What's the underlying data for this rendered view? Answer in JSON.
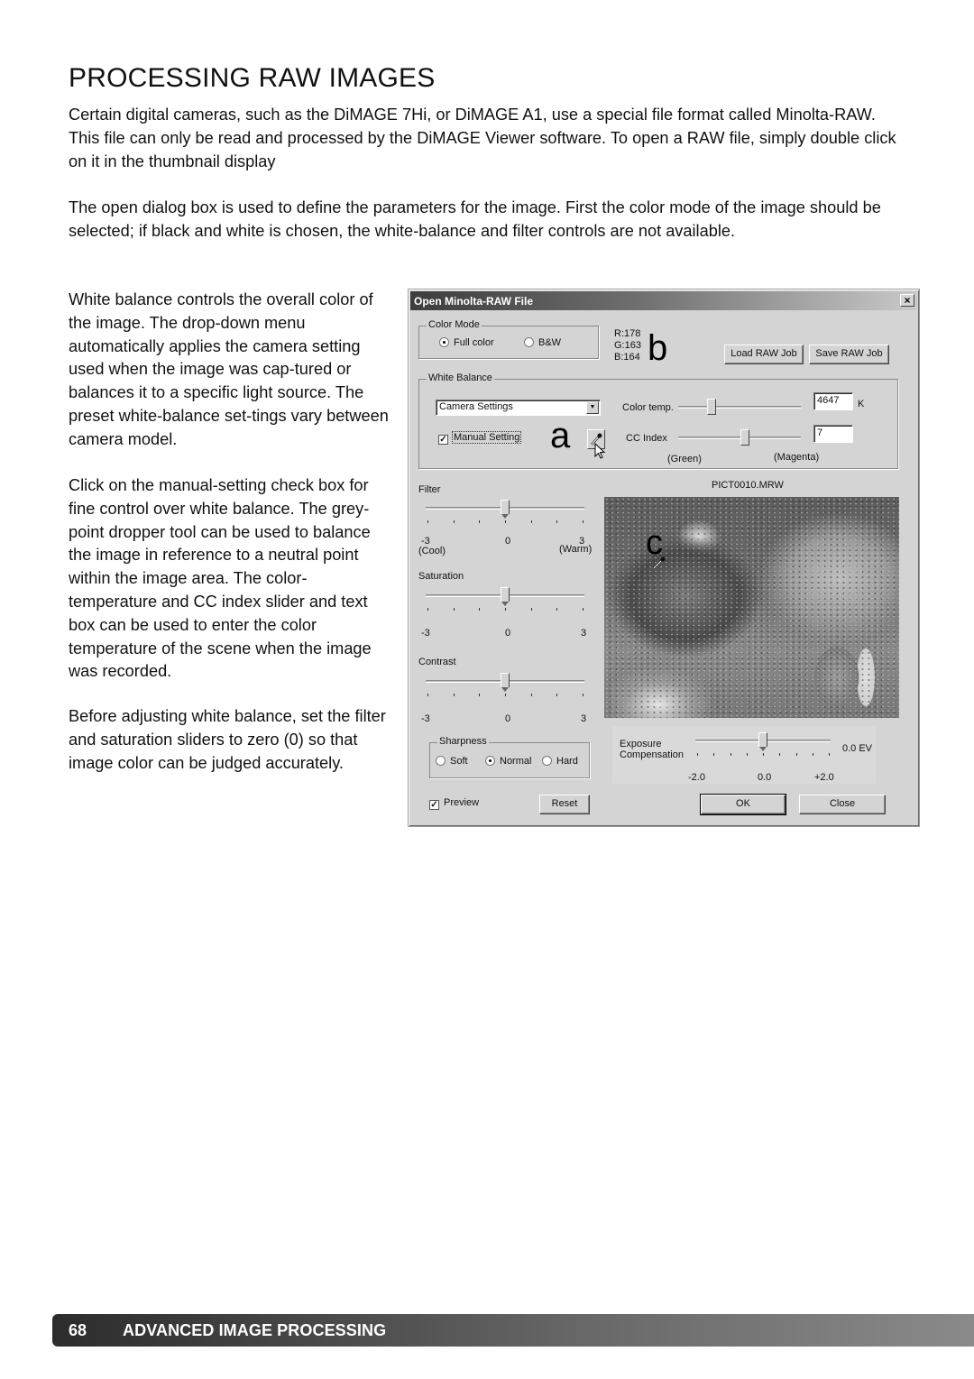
{
  "page": {
    "title": "PROCESSING RAW IMAGES",
    "paragraphs": [
      "Certain digital cameras, such as the DiMAGE 7Hi, or DiMAGE A1, use a special file format called Minolta-RAW. This file can only be read and processed by the DiMAGE Viewer software. To open a RAW file, simply double click on it in the thumbnail display",
      "The open dialog box is used to define the parameters for the image. First the color mode of the image should be selected; if black and white is chosen, the white-balance and filter controls are not available.",
      "White balance controls the overall color of the image. The drop-down menu automatically applies the camera setting used when the image was cap-tured or balances it to a specific light source. The preset white-balance set-tings vary between camera model.",
      "Click on the manual-setting check box for fine control over white balance. The grey-point dropper tool can be used to balance the image in reference to a neutral point within the image area. The color-temperature and CC index slider and text box can be used to enter the color temperature of the scene when the image was recorded.",
      "Before adjusting white balance, set the filter and saturation sliders to zero (0) so that image color can be judged accurately."
    ],
    "footer": {
      "page_number": "68",
      "section": "ADVANCED IMAGE PROCESSING"
    }
  },
  "dialog": {
    "title": "Open Minolta-RAW File",
    "close_label": "×",
    "color_mode": {
      "label": "Color Mode",
      "options": [
        {
          "label": "Full color",
          "selected": true
        },
        {
          "label": "B&W",
          "selected": false
        }
      ]
    },
    "rgb_readout": {
      "r": "R:178",
      "g": "G:163",
      "b": "B:164"
    },
    "callouts": {
      "a": "a",
      "b": "b",
      "c": "c"
    },
    "load_button": "Load RAW Job",
    "save_button": "Save RAW Job",
    "white_balance": {
      "label": "White Balance",
      "preset_value": "Camera Settings",
      "manual_setting_label": "Manual Setting",
      "manual_setting_checked": true,
      "color_temp_label": "Color temp.",
      "color_temp_value": "4647",
      "color_temp_unit": "K",
      "color_temp_slider_fraction": 0.25,
      "cc_index_label": "CC Index",
      "cc_index_value": "7",
      "cc_index_slider_fraction": 0.55,
      "green_label": "(Green)",
      "magenta_label": "(Magenta)"
    },
    "filter": {
      "label": "Filter",
      "value": 0,
      "min_label": "-3",
      "mid_label": "0",
      "max_label": "3",
      "cool_label": "(Cool)",
      "warm_label": "(Warm)"
    },
    "saturation": {
      "label": "Saturation",
      "value": 0,
      "min_label": "-3",
      "mid_label": "0",
      "max_label": "3"
    },
    "contrast": {
      "label": "Contrast",
      "value": 0,
      "min_label": "-3",
      "mid_label": "0",
      "max_label": "3"
    },
    "sharpness": {
      "label": "Sharpness",
      "options": [
        {
          "label": "Soft",
          "selected": false
        },
        {
          "label": "Normal",
          "selected": true
        },
        {
          "label": "Hard",
          "selected": false
        }
      ]
    },
    "preview_label": "Preview",
    "preview_checked": true,
    "reset_button": "Reset",
    "filename": "PICT0010.MRW",
    "exposure": {
      "label_line1": "Exposure",
      "label_line2": "Compensation",
      "value": "0.0 EV",
      "min_label": "-2.0",
      "mid_label": "0.0",
      "max_label": "+2.0"
    },
    "ok_button": "OK",
    "close_button": "Close"
  }
}
